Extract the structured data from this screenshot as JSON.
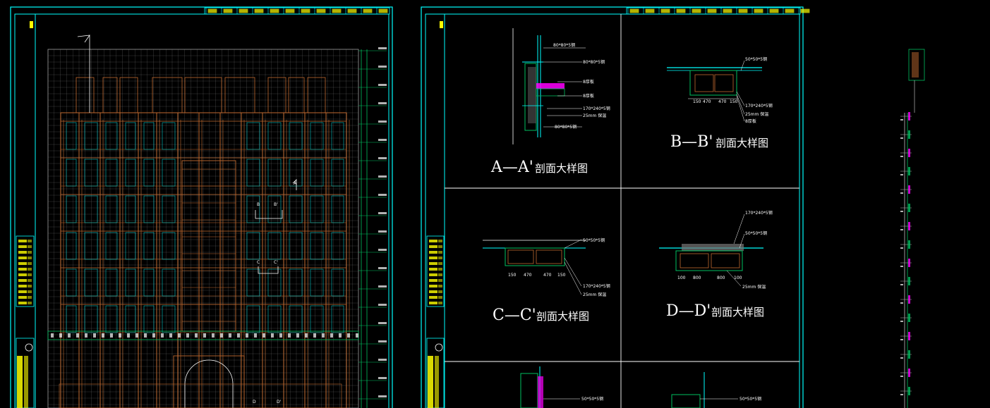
{
  "sheets": [
    {
      "id": "sheet-elevation"
    },
    {
      "id": "sheet-details"
    },
    {
      "id": "sheet-side-elevation"
    }
  ],
  "detail_titles": {
    "a": {
      "mark": "A—A'",
      "text": "剖面大样图"
    },
    "b": {
      "mark": "B—B'",
      "text": "剖面大样图"
    },
    "c": {
      "mark": "C—C'",
      "text": "剖面大样图"
    },
    "d": {
      "mark": "D—D'",
      "text": "剖面大样图"
    }
  },
  "callouts": {
    "steel_tube_170": "170*240*5钢",
    "steel_angle_50": "50*50*5钢",
    "insulation_25": "25mm 保温",
    "steel_80": "80*80*5钢",
    "board_8": "8厚板",
    "dims_b": [
      "150",
      "470",
      "470",
      "150"
    ],
    "dims_c": [
      "150",
      "470",
      "470",
      "150"
    ],
    "dims_d": [
      "100",
      "800",
      "800",
      "100"
    ]
  },
  "elevation_markers": {
    "b": "B",
    "b_prime": "B'",
    "c": "C",
    "c_prime": "C'",
    "d": "D",
    "d_prime": "D'",
    "a": "A"
  },
  "colors": {
    "frame": "#00ffff",
    "grid": "#9a9a9a",
    "facade": "#c06a30",
    "accent_green": "#00c060",
    "accent_yellow": "#ffff00",
    "accent_magenta": "#ff00ff",
    "text": "#ffffff"
  }
}
